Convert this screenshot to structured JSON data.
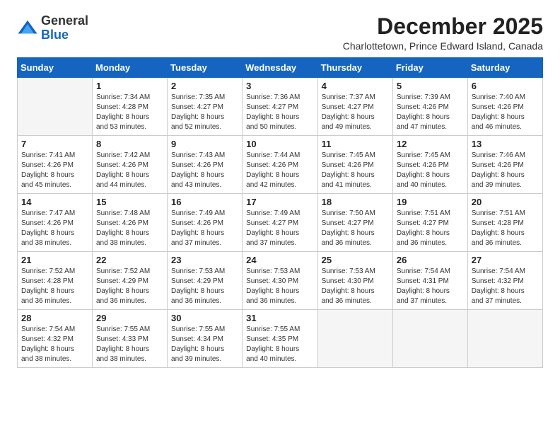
{
  "logo": {
    "general": "General",
    "blue": "Blue"
  },
  "title": "December 2025",
  "subtitle": "Charlottetown, Prince Edward Island, Canada",
  "days_of_week": [
    "Sunday",
    "Monday",
    "Tuesday",
    "Wednesday",
    "Thursday",
    "Friday",
    "Saturday"
  ],
  "weeks": [
    [
      {
        "day": "",
        "info": ""
      },
      {
        "day": "1",
        "info": "Sunrise: 7:34 AM\nSunset: 4:28 PM\nDaylight: 8 hours\nand 53 minutes."
      },
      {
        "day": "2",
        "info": "Sunrise: 7:35 AM\nSunset: 4:27 PM\nDaylight: 8 hours\nand 52 minutes."
      },
      {
        "day": "3",
        "info": "Sunrise: 7:36 AM\nSunset: 4:27 PM\nDaylight: 8 hours\nand 50 minutes."
      },
      {
        "day": "4",
        "info": "Sunrise: 7:37 AM\nSunset: 4:27 PM\nDaylight: 8 hours\nand 49 minutes."
      },
      {
        "day": "5",
        "info": "Sunrise: 7:39 AM\nSunset: 4:26 PM\nDaylight: 8 hours\nand 47 minutes."
      },
      {
        "day": "6",
        "info": "Sunrise: 7:40 AM\nSunset: 4:26 PM\nDaylight: 8 hours\nand 46 minutes."
      }
    ],
    [
      {
        "day": "7",
        "info": "Sunrise: 7:41 AM\nSunset: 4:26 PM\nDaylight: 8 hours\nand 45 minutes."
      },
      {
        "day": "8",
        "info": "Sunrise: 7:42 AM\nSunset: 4:26 PM\nDaylight: 8 hours\nand 44 minutes."
      },
      {
        "day": "9",
        "info": "Sunrise: 7:43 AM\nSunset: 4:26 PM\nDaylight: 8 hours\nand 43 minutes."
      },
      {
        "day": "10",
        "info": "Sunrise: 7:44 AM\nSunset: 4:26 PM\nDaylight: 8 hours\nand 42 minutes."
      },
      {
        "day": "11",
        "info": "Sunrise: 7:45 AM\nSunset: 4:26 PM\nDaylight: 8 hours\nand 41 minutes."
      },
      {
        "day": "12",
        "info": "Sunrise: 7:45 AM\nSunset: 4:26 PM\nDaylight: 8 hours\nand 40 minutes."
      },
      {
        "day": "13",
        "info": "Sunrise: 7:46 AM\nSunset: 4:26 PM\nDaylight: 8 hours\nand 39 minutes."
      }
    ],
    [
      {
        "day": "14",
        "info": "Sunrise: 7:47 AM\nSunset: 4:26 PM\nDaylight: 8 hours\nand 38 minutes."
      },
      {
        "day": "15",
        "info": "Sunrise: 7:48 AM\nSunset: 4:26 PM\nDaylight: 8 hours\nand 38 minutes."
      },
      {
        "day": "16",
        "info": "Sunrise: 7:49 AM\nSunset: 4:26 PM\nDaylight: 8 hours\nand 37 minutes."
      },
      {
        "day": "17",
        "info": "Sunrise: 7:49 AM\nSunset: 4:27 PM\nDaylight: 8 hours\nand 37 minutes."
      },
      {
        "day": "18",
        "info": "Sunrise: 7:50 AM\nSunset: 4:27 PM\nDaylight: 8 hours\nand 36 minutes."
      },
      {
        "day": "19",
        "info": "Sunrise: 7:51 AM\nSunset: 4:27 PM\nDaylight: 8 hours\nand 36 minutes."
      },
      {
        "day": "20",
        "info": "Sunrise: 7:51 AM\nSunset: 4:28 PM\nDaylight: 8 hours\nand 36 minutes."
      }
    ],
    [
      {
        "day": "21",
        "info": "Sunrise: 7:52 AM\nSunset: 4:28 PM\nDaylight: 8 hours\nand 36 minutes."
      },
      {
        "day": "22",
        "info": "Sunrise: 7:52 AM\nSunset: 4:29 PM\nDaylight: 8 hours\nand 36 minutes."
      },
      {
        "day": "23",
        "info": "Sunrise: 7:53 AM\nSunset: 4:29 PM\nDaylight: 8 hours\nand 36 minutes."
      },
      {
        "day": "24",
        "info": "Sunrise: 7:53 AM\nSunset: 4:30 PM\nDaylight: 8 hours\nand 36 minutes."
      },
      {
        "day": "25",
        "info": "Sunrise: 7:53 AM\nSunset: 4:30 PM\nDaylight: 8 hours\nand 36 minutes."
      },
      {
        "day": "26",
        "info": "Sunrise: 7:54 AM\nSunset: 4:31 PM\nDaylight: 8 hours\nand 37 minutes."
      },
      {
        "day": "27",
        "info": "Sunrise: 7:54 AM\nSunset: 4:32 PM\nDaylight: 8 hours\nand 37 minutes."
      }
    ],
    [
      {
        "day": "28",
        "info": "Sunrise: 7:54 AM\nSunset: 4:32 PM\nDaylight: 8 hours\nand 38 minutes."
      },
      {
        "day": "29",
        "info": "Sunrise: 7:55 AM\nSunset: 4:33 PM\nDaylight: 8 hours\nand 38 minutes."
      },
      {
        "day": "30",
        "info": "Sunrise: 7:55 AM\nSunset: 4:34 PM\nDaylight: 8 hours\nand 39 minutes."
      },
      {
        "day": "31",
        "info": "Sunrise: 7:55 AM\nSunset: 4:35 PM\nDaylight: 8 hours\nand 40 minutes."
      },
      {
        "day": "",
        "info": ""
      },
      {
        "day": "",
        "info": ""
      },
      {
        "day": "",
        "info": ""
      }
    ]
  ]
}
